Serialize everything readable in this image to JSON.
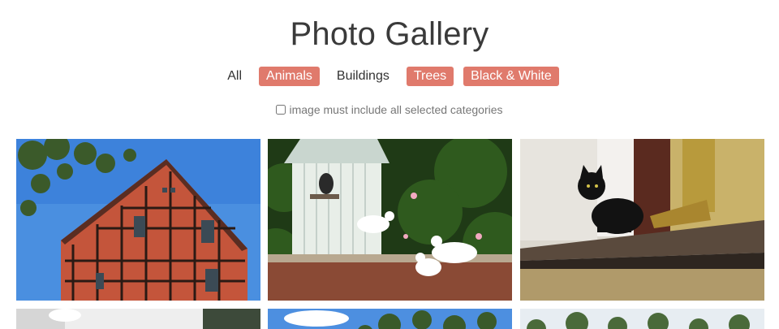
{
  "page": {
    "title": "Photo Gallery"
  },
  "filters": {
    "items": [
      {
        "label": "All",
        "active": false
      },
      {
        "label": "Animals",
        "active": true
      },
      {
        "label": "Buildings",
        "active": false
      },
      {
        "label": "Trees",
        "active": true
      },
      {
        "label": "Black & White",
        "active": true
      }
    ]
  },
  "options": {
    "match_all_label": "image must include all selected categories",
    "match_all_checked": false
  },
  "colors": {
    "accent": "#e07a6c",
    "text": "#333333",
    "muted": "#777777"
  },
  "gallery": {
    "tiles": [
      {
        "name": "photo-half-timbered-house",
        "subject": "half-timbered brick house under blue sky"
      },
      {
        "name": "photo-doves-dovecote",
        "subject": "white doves near a dovecote with flowers"
      },
      {
        "name": "photo-black-cat-roof",
        "subject": "black cat on a roof ledge"
      },
      {
        "name": "photo-white-wall",
        "subject": "white wall partially visible"
      },
      {
        "name": "photo-sky-trees",
        "subject": "sky with treetops partially visible"
      },
      {
        "name": "photo-forest",
        "subject": "forest treetops partially visible"
      }
    ]
  }
}
